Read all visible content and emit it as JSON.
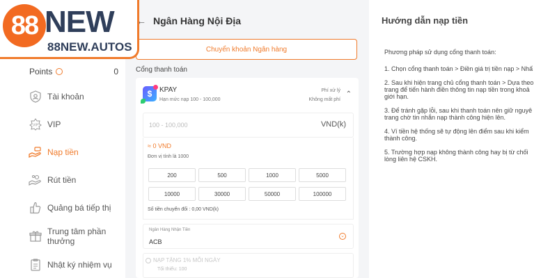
{
  "brand": {
    "mark": "88",
    "word": "NEW",
    "domain": "88NEW.AUTOS"
  },
  "sidebar": {
    "points_label": "Points",
    "points_value": "0",
    "items": [
      {
        "label": "Tài khoản",
        "icon": "user-shield-icon",
        "active": false
      },
      {
        "label": "VIP",
        "icon": "vip-badge-icon",
        "active": false
      },
      {
        "label": "Nạp tiền",
        "icon": "deposit-hand-icon",
        "active": true
      },
      {
        "label": "Rút tiền",
        "icon": "withdraw-hand-icon",
        "active": false
      },
      {
        "label": "Quảng bá tiếp thị",
        "icon": "promotion-hand-icon",
        "active": false
      },
      {
        "label": "Trung tâm phần thưởng",
        "icon": "gift-icon",
        "active": false
      },
      {
        "label": "Nhật ký nhiệm vụ",
        "icon": "task-list-icon",
        "active": false
      }
    ]
  },
  "deposit": {
    "back_icon": "arrow-left-icon",
    "title": "Ngân Hàng Nội Địa",
    "transfer_button": "Chuyển khoản Ngân hàng",
    "gateway_label": "Cổng thanh toán",
    "gateway": {
      "name": "KPAY",
      "limit": "Hạn mức nạp 100 - 100,000",
      "fee_line1": "Phí xử lý",
      "fee_line2": "Không mất phí"
    },
    "amount_placeholder": "100 - 100,000",
    "amount_unit": "VND(k)",
    "approx": "≈ 0 VND",
    "unit_note": "Đơn vị tính là 1000",
    "chips": [
      "200",
      "500",
      "1000",
      "5000",
      "10000",
      "30000",
      "50000",
      "100000"
    ],
    "converted": "Số tiền chuyển đổi : 0,00 VND(k)",
    "bank_label": "Ngân Hàng Nhận Tiền",
    "bank_value": "ACB",
    "promo_title": "NẠP TẶNG 1% MỖI NGÀY",
    "promo_min": "Tối thiểu: 100"
  },
  "guide": {
    "title": "Hướng dẫn nạp tiền",
    "paragraphs": [
      "Phương pháp sử dụng cổng thanh toán:",
      "1. Chọn cổng thanh toán > Điền giá trị tiền nạp > Nhấ",
      "2. Sau khi hiện trang chủ cổng thanh toán > Dựa theo\ntrang để tiến hành điền thông tin nạp tiền trong khoả\ngiới hạn.",
      "3. Để tránh gặp lỗi, sau khi thanh toán nên giữ nguyê\ntrang chờ tin nhắn nạp thành công hiện lên.",
      "4. Ví tiền hệ thống sẽ tự động lên điểm sau khi kiểm\nthành công.",
      "5. Trường hợp nạp không thành công hay bị từ chối\nlòng liên hệ CSKH."
    ]
  },
  "colors": {
    "accent": "#f07a2a",
    "brand_dark": "#2f3e5a"
  }
}
